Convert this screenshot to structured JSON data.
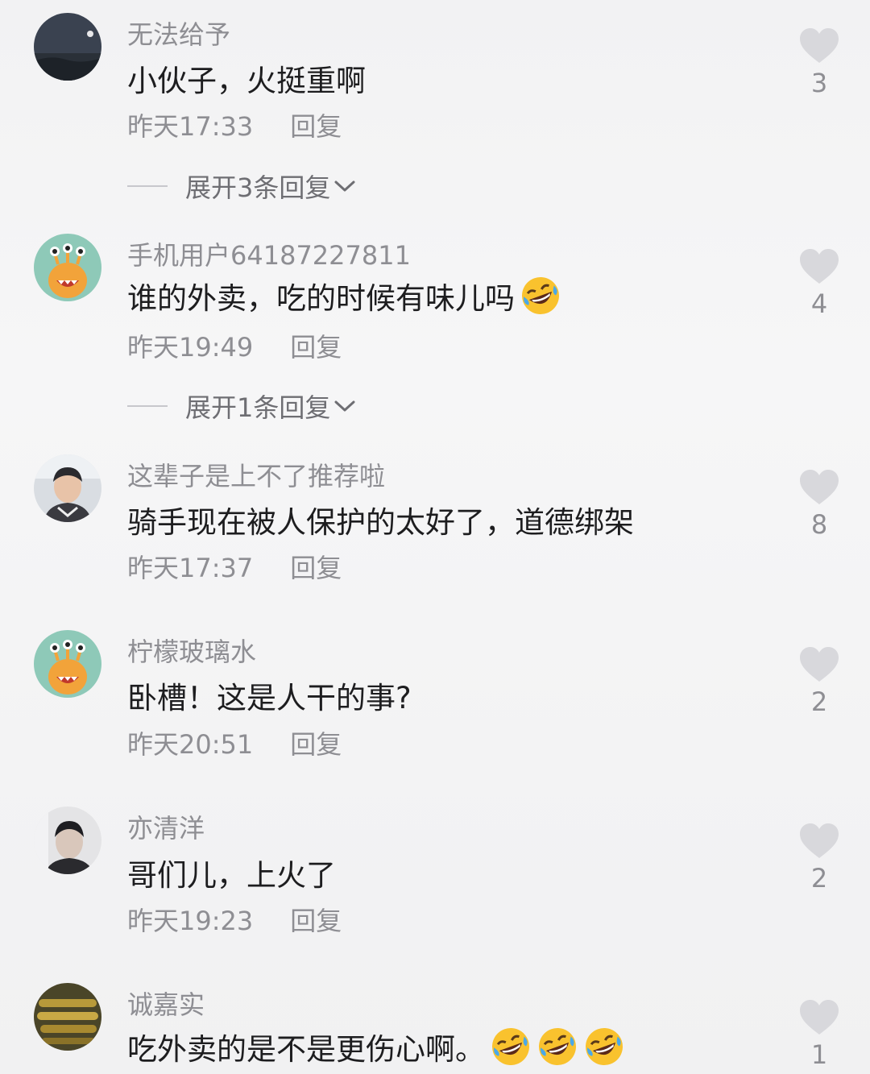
{
  "comments": [
    {
      "username": "无法给予",
      "text": "小伙子，火挺重啊",
      "time": "昨天17:33",
      "reply": "回复",
      "likes": "3",
      "expand": "展开3条回复",
      "avatar_icon": "night-sky-avatar"
    },
    {
      "username": "手机用户64187227811",
      "text": "谁的外卖，吃的时候有味儿吗",
      "emoji_count": 1,
      "time": "昨天19:49",
      "reply": "回复",
      "likes": "4",
      "expand": "展开1条回复",
      "avatar_icon": "monster-avatar"
    },
    {
      "username": "这辈子是上不了推荐啦",
      "text": "骑手现在被人保护的太好了，道德绑架",
      "time": "昨天17:37",
      "reply": "回复",
      "likes": "8",
      "avatar_icon": "person-photo-avatar"
    },
    {
      "username": "柠檬玻璃水",
      "text": "卧槽！这是人干的事?",
      "time": "昨天20:51",
      "reply": "回复",
      "likes": "2",
      "avatar_icon": "monster-avatar"
    },
    {
      "username": "亦清洋",
      "text": "哥们儿，上火了",
      "time": "昨天19:23",
      "reply": "回复",
      "likes": "2",
      "avatar_icon": "person-photo-avatar"
    },
    {
      "username": "诚嘉实",
      "text": "吃外卖的是不是更伤心啊。",
      "emoji_count": 3,
      "time": "",
      "reply": "",
      "likes": "1",
      "avatar_icon": "bullets-photo-avatar"
    }
  ],
  "colors": {
    "text": "#1d1d1f",
    "secondary": "#8e8e93",
    "heart": "#d8d8dc",
    "background": "#f4f4f5"
  },
  "icons": {
    "like": "heart-icon",
    "expand": "chevron-down-icon",
    "emoji": "rolling-on-floor-laughing-emoji"
  }
}
